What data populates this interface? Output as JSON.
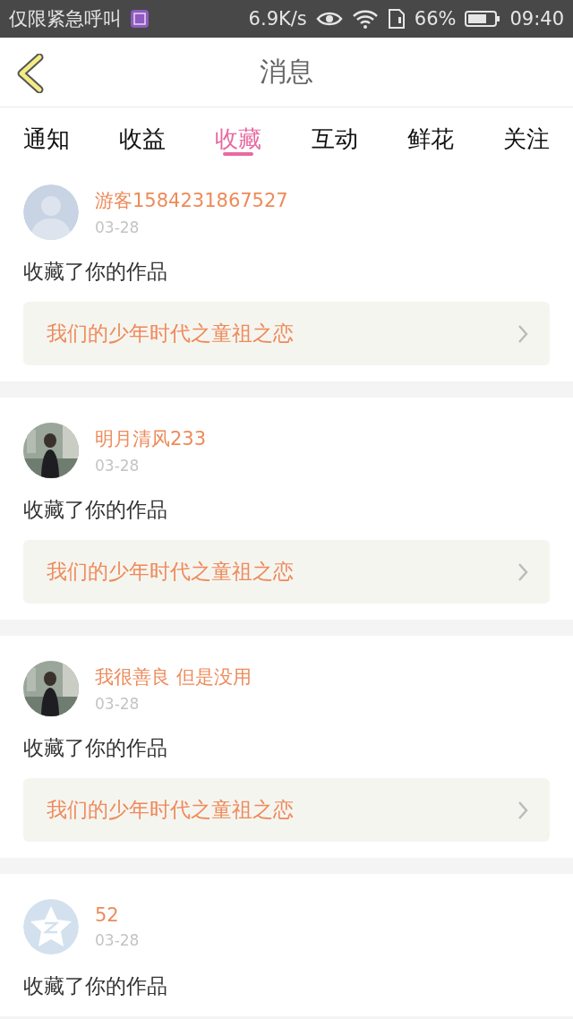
{
  "status_bar": {
    "carrier": "仅限紧急呼叫",
    "speed": "6.9K/s",
    "battery": "66%",
    "time": "09:40"
  },
  "header": {
    "title": "消息"
  },
  "tabs": [
    {
      "label": "通知",
      "selected": false
    },
    {
      "label": "收益",
      "selected": false
    },
    {
      "label": "收藏",
      "selected": true
    },
    {
      "label": "互动",
      "selected": false
    },
    {
      "label": "鲜花",
      "selected": false
    },
    {
      "label": "关注",
      "selected": false
    }
  ],
  "messages": [
    {
      "avatar": {
        "kind": "default"
      },
      "name": "游客1584231867527",
      "date": "03-28",
      "text": "收藏了你的作品",
      "work": "我们的少年时代之童祖之恋"
    },
    {
      "name": "明月清风233",
      "date": "03-28",
      "text": "收藏了你的作品",
      "work": "我们的少年时代之童祖之恋"
    },
    {
      "name": "我很善良 但是没用",
      "date": "03-28",
      "text": "收藏了你的作品",
      "work": "我们的少年时代之童祖之恋"
    },
    {
      "avatar": {
        "kind": "star"
      },
      "name": "52",
      "date": "03-28",
      "text": "收藏了你的作品"
    }
  ]
}
